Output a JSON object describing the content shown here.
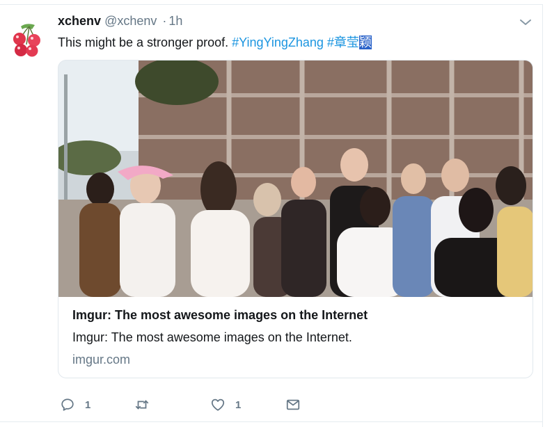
{
  "tweet": {
    "name": "xchenv",
    "handle": "@xchenv",
    "separator": "·",
    "time": "1h",
    "text": "This might be a stronger proof.",
    "hashtags": [
      "#YingYingZhang",
      "#章莹",
      "颖"
    ]
  },
  "card": {
    "title": "Imgur: The most awesome images on the Internet",
    "description": "Imgur: The most awesome images on the Internet.",
    "domain": "imgur.com"
  },
  "actions": {
    "reply_count": "1",
    "retweet_count": "",
    "like_count": "1"
  },
  "colors": {
    "link": "#1b95e0",
    "secondary_text": "#657786",
    "selection": "#2a62c9"
  }
}
